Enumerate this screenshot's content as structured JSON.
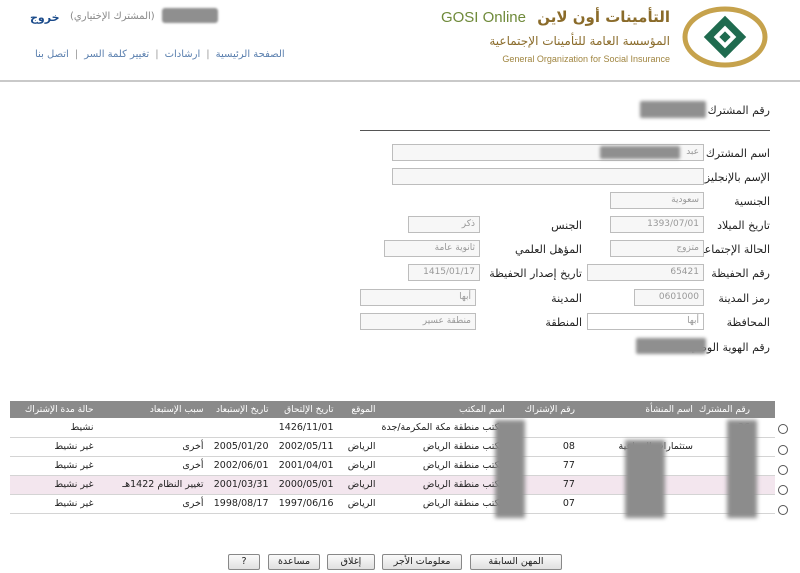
{
  "header": {
    "brand_ar": "التأمينات أون لاين",
    "brand_en": "GOSI Online",
    "org_ar": "المؤسسة العامة للتأمينات الإجتماعية",
    "org_en": "General Organization for Social Insurance",
    "logout": "خروج",
    "user_type": "(المشترك الإختياري)",
    "nav": [
      "الصفحة الرئيسية",
      "ارشادات",
      "تغيير كلمة السر",
      "اتصل بنا"
    ],
    "accent_color": "#8a6b2a"
  },
  "form": {
    "subscriber_number_label": "رقم المشترك",
    "subscriber_name_label": "اسم المشترك",
    "subscriber_name_value": "عبد",
    "english_name_label": "الإسم بالإنجليزي",
    "nationality_label": "الجنسية",
    "nationality_value": "سعودية",
    "birth_date_label": "تاريخ الميلاد",
    "birth_date_value": "1393/07/01",
    "gender_label": "الجنس",
    "gender_value": "ذكر",
    "marital_label": "الحالة الإجتماعية",
    "marital_value": "متزوج",
    "education_label": "المؤهل العلمي",
    "education_value": "ثانوية عامة",
    "civil_reg_label": "رقم الحفيظة",
    "civil_reg_value": "65421",
    "civil_issue_label": "تاريخ إصدار الحفيظة",
    "civil_issue_value": "1415/01/17",
    "city_code_label": "رمز المدينة",
    "city_code_value": "0601000",
    "city_label": "المدينة",
    "city_value": "أبها",
    "governorate_label": "المحافظة",
    "governorate_value": "أبها",
    "region_label": "المنطقة",
    "region_value": "منطقة عسير",
    "national_id_label": "رقم الهوية الوطنية"
  },
  "table": {
    "headers": [
      "رقم المشترك",
      "اسم المنشأة",
      "رقم الإشتراك",
      "اسم المكتب",
      "الموقع",
      "تاريخ الإلتحاق",
      "تاريخ الإستبعاد",
      "سبب الإستبعاد",
      "حالة مدة الإشتراك"
    ],
    "rows": [
      {
        "est": "",
        "sub": "",
        "office": "مكتب منطقة مكة المكرمة/جدة",
        "loc": "",
        "join": "1426/11/01",
        "excl": "",
        "reason": "",
        "status": "نشيط"
      },
      {
        "est": "ستثمارات الصناعية",
        "sub": "08",
        "office": "مكتب منطقة الرياض",
        "loc": "الرياض",
        "join": "2002/05/11",
        "excl": "2005/01/20",
        "reason": "أخرى",
        "status": "غير نشيط"
      },
      {
        "est": "",
        "sub": "77",
        "office": "مكتب منطقة الرياض",
        "loc": "الرياض",
        "join": "2001/04/01",
        "excl": "2002/06/01",
        "reason": "أخرى",
        "status": "غير نشيط"
      },
      {
        "est": "",
        "sub": "77",
        "office": "مكتب منطقة الرياض",
        "loc": "الرياض",
        "join": "2000/05/01",
        "excl": "2001/03/31",
        "reason": "تغيير النظام 1422هـ",
        "status": "غير نشيط"
      },
      {
        "est": "",
        "sub": "07",
        "office": "مكتب منطقة الرياض",
        "loc": "الرياض",
        "join": "1997/06/16",
        "excl": "1998/08/17",
        "reason": "أخرى",
        "status": "غير نشيط"
      }
    ]
  },
  "buttons": {
    "prev_jobs": "المهن السابقة",
    "wage_info": "معلومات الأجر",
    "close": "إغلاق",
    "help": "مساعدة",
    "q": "?"
  }
}
